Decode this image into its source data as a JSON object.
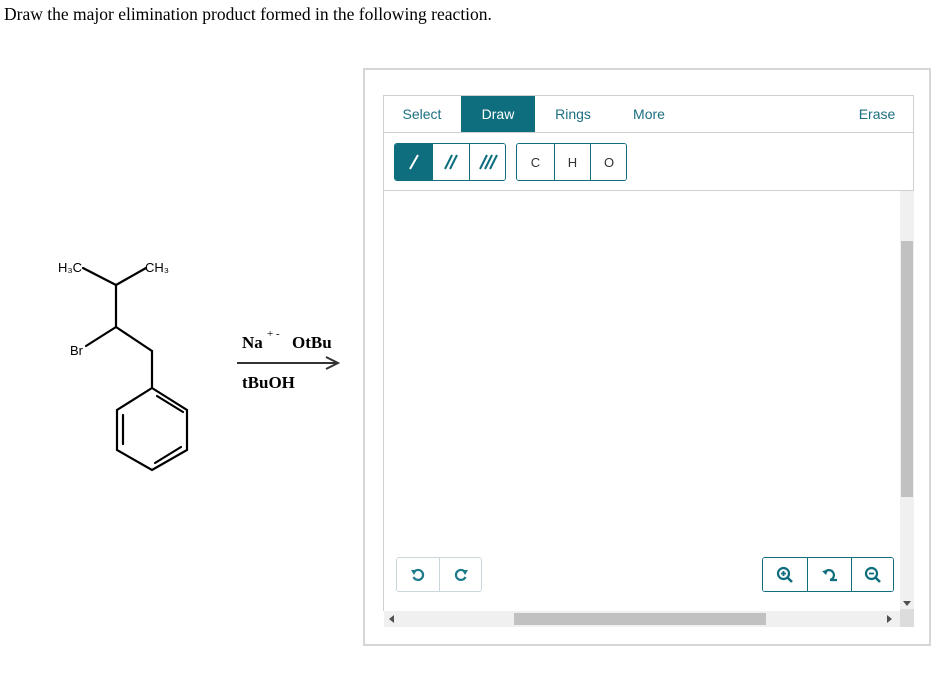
{
  "question": "Draw the major elimination product formed in the following reaction.",
  "reaction": {
    "label_h3c": "H₃C",
    "label_ch3": "CH₃",
    "label_br": "Br",
    "reagent_na": "Na",
    "reagent_charges": "+ -",
    "reagent_otbu": "OtBu",
    "solvent": "tBuOH"
  },
  "editor": {
    "tabs": [
      "Select",
      "Draw",
      "Rings",
      "More",
      "Erase"
    ],
    "active_tab": "Draw",
    "bond_tools": [
      "single-bond",
      "double-bond",
      "triple-bond"
    ],
    "atoms": [
      "C",
      "H",
      "O"
    ],
    "colors": {
      "accent": "#0e6e7d",
      "tab_text": "#1c6f80"
    }
  }
}
